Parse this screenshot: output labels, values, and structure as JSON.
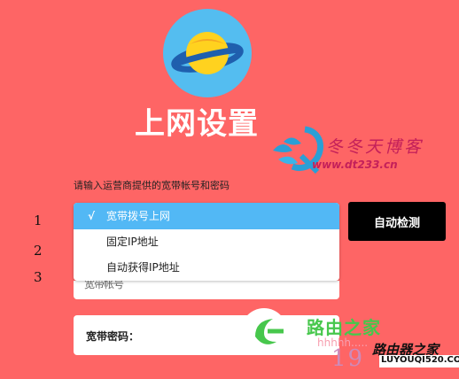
{
  "logo": {
    "icon": "planet-icon"
  },
  "title": "上网设置",
  "watermark_top": {
    "name": "冬冬天博客",
    "url": "www.dt233.cn"
  },
  "hint": "请输入运营商提供的宽带帐号和密码",
  "row_numbers": [
    "1",
    "2",
    "3"
  ],
  "connection_type": {
    "selected_mark": "√",
    "options": [
      "宽带拨号上网",
      "固定IP地址",
      "自动获得IP地址"
    ]
  },
  "covered_field_text": "宽带帐号",
  "detect_button": "自动检测",
  "password_label": "宽带密码：",
  "watermark_bottom": {
    "name": "路由之家",
    "sub": "hhhhh.....",
    "number": "19",
    "brand": "路由器之家",
    "url": "LUYOUQI520.COM"
  },
  "colors": {
    "background": "#fe6565",
    "selected_option": "#52b8f5",
    "logo_circle": "#54bdf0",
    "watermark_top": "#c4205a",
    "watermark_bottom": "#47c74c"
  }
}
